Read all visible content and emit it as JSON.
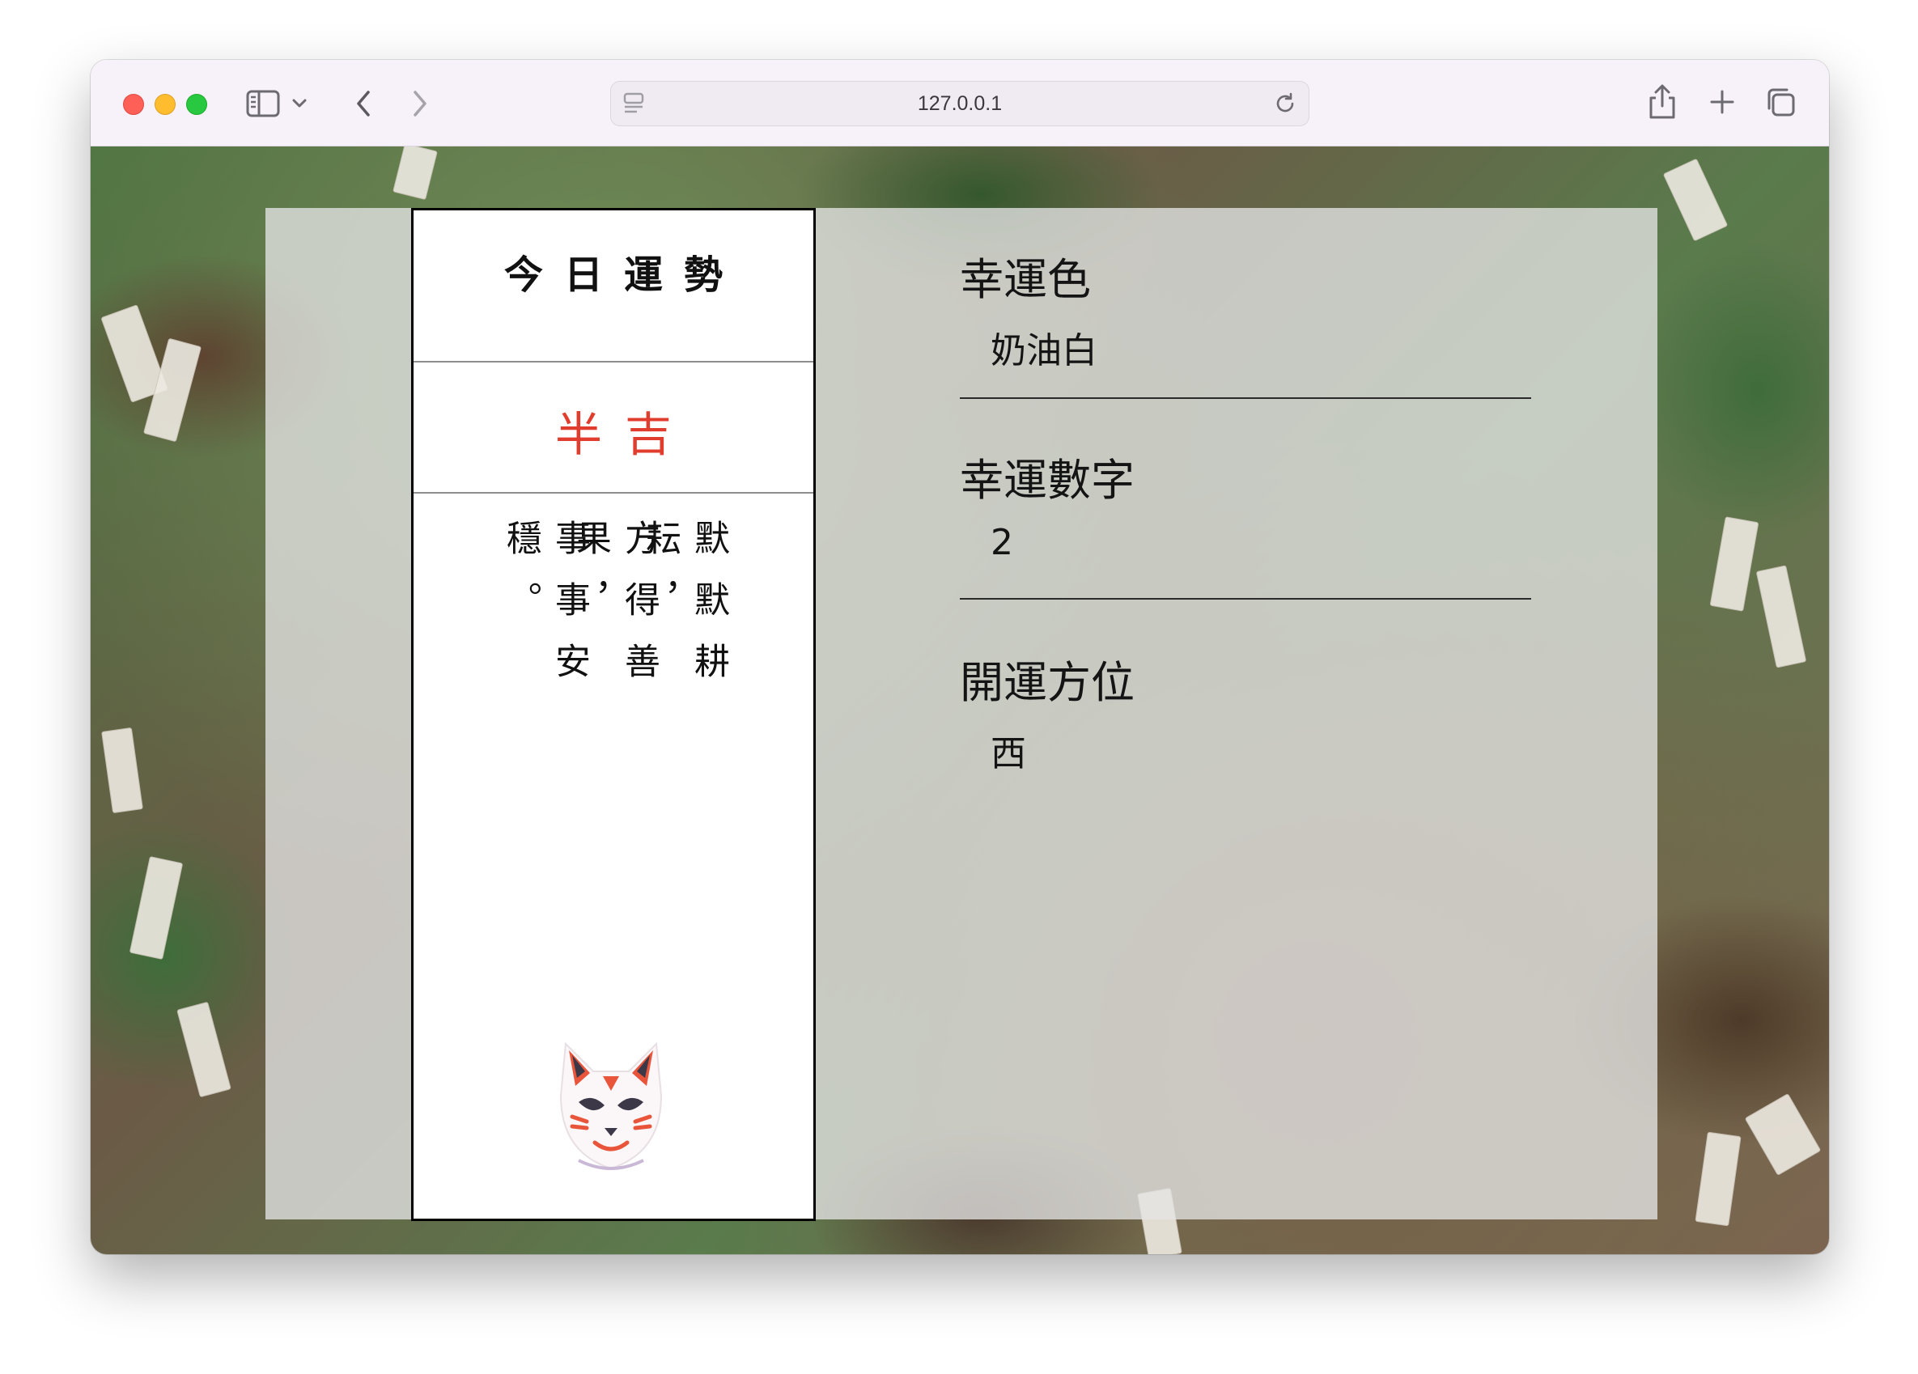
{
  "browser": {
    "url": "127.0.0.1",
    "icons": {
      "sidebar": "sidebar-icon",
      "back": "chevron-left-icon",
      "forward": "chevron-right-icon",
      "reload": "reload-icon",
      "share": "share-icon",
      "new_tab": "plus-icon",
      "tabs": "tabs-overview-icon"
    },
    "traffic_lights": {
      "close": "#fe5f57",
      "minimize": "#febc2e",
      "maximize": "#28c840"
    }
  },
  "omikuji": {
    "title": "今日運勢",
    "fortune": "半吉",
    "fortune_color": "#e13d2e",
    "poem_columns": [
      "默默耕耘，",
      "方得善果，",
      "事事安穩。"
    ],
    "mascot": "fox-mask-icon"
  },
  "info": [
    {
      "label": "幸運色",
      "value": "奶油白"
    },
    {
      "label": "幸運數字",
      "value": "2"
    },
    {
      "label": "開運方位",
      "value": "西"
    }
  ]
}
